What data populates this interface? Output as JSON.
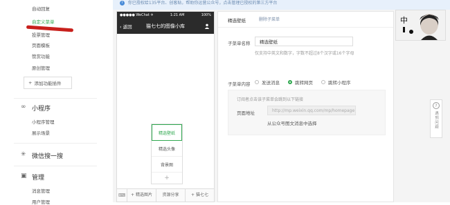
{
  "sidebar": {
    "items": [
      {
        "label": "自动回复",
        "active": false
      },
      {
        "label": "自定义菜单",
        "active": true
      },
      {
        "label": "投票管理",
        "active": false
      },
      {
        "label": "页面模板",
        "active": false
      },
      {
        "label": "赞赏功能",
        "active": false
      },
      {
        "label": "原创管理",
        "active": false
      }
    ],
    "add_plugin": "添加功能插件",
    "sections": [
      {
        "title": "小程序",
        "icon": "link-icon",
        "items": [
          "小程序管理",
          "展示场景"
        ]
      },
      {
        "title": "微信搜一搜",
        "icon": "sparkle-icon",
        "items": []
      },
      {
        "title": "管理",
        "icon": "folder-icon",
        "items": [
          "消息管理",
          "用户管理"
        ]
      }
    ]
  },
  "notice": {
    "text": "你已授权给135平台、创客贴，帮助你运营公众号，点击管理已授权的第三方平台"
  },
  "phone": {
    "status": {
      "carrier": "●●●●● WeChat ✈",
      "time": "1:21 AM",
      "battery": "100%"
    },
    "back_label": "返回",
    "title": "猫七七的图像小库",
    "submenu": [
      "精选壁纸",
      "精选头像",
      "背景图"
    ],
    "submenu_plus": "+",
    "tabs": [
      "精选图片",
      "资源分享",
      "猫七七"
    ],
    "tab_prefixes": [
      "+",
      "",
      "+"
    ]
  },
  "editor": {
    "title": "精选壁纸",
    "delete_label": "删除子菜单",
    "name_label": "子菜单名称",
    "name_value": "精选壁纸",
    "name_hint": "仅支持中英文和数字，字数不超过8个汉字或16个字母",
    "content_label": "子菜单内容",
    "radio_options": [
      "发送消息",
      "跳转网页",
      "跳转小程序"
    ],
    "radio_selected": 1,
    "url_hint": "订阅者点击该子菜单会跳到以下链接",
    "url_label": "页面地址",
    "url_placeholder": "http://mp.weixin.qq.com/mp/homepage",
    "url_link": "从公众号图文消息中选择"
  },
  "help": {
    "label": "遇到问题"
  },
  "colors": {
    "accent": "#2fa84f",
    "nav": "#2b2b2b",
    "mark": "#c8201c"
  }
}
